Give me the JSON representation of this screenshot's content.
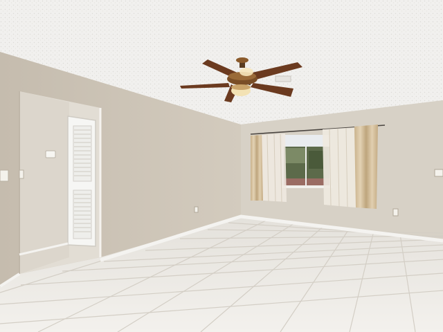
{
  "scene": {
    "description_label": "",
    "colors": {
      "ceiling": "#f1f0ee",
      "left_wall": "#cfc6b8",
      "back_wall": "#d7d1c6",
      "closet_wall": "#e2ddd4",
      "floor": "#ece9e3",
      "grout": "#d6d1c8",
      "baseboard": "#f4f3f0",
      "door": "#f6f6f4",
      "curtain": "#d9c6a5",
      "curtain_dark": "#b89f78",
      "sheer": "#efe9e0",
      "fan_blade": "#6b3a1f",
      "fan_body": "#8a5a2b",
      "fan_light": "#f3e2b4",
      "window_view": "#5c6a4a"
    },
    "objects": [
      "ceiling-fan",
      "window",
      "curtains",
      "louvered-door",
      "thermostat",
      "light-switch",
      "outlets",
      "tile-floor"
    ]
  }
}
